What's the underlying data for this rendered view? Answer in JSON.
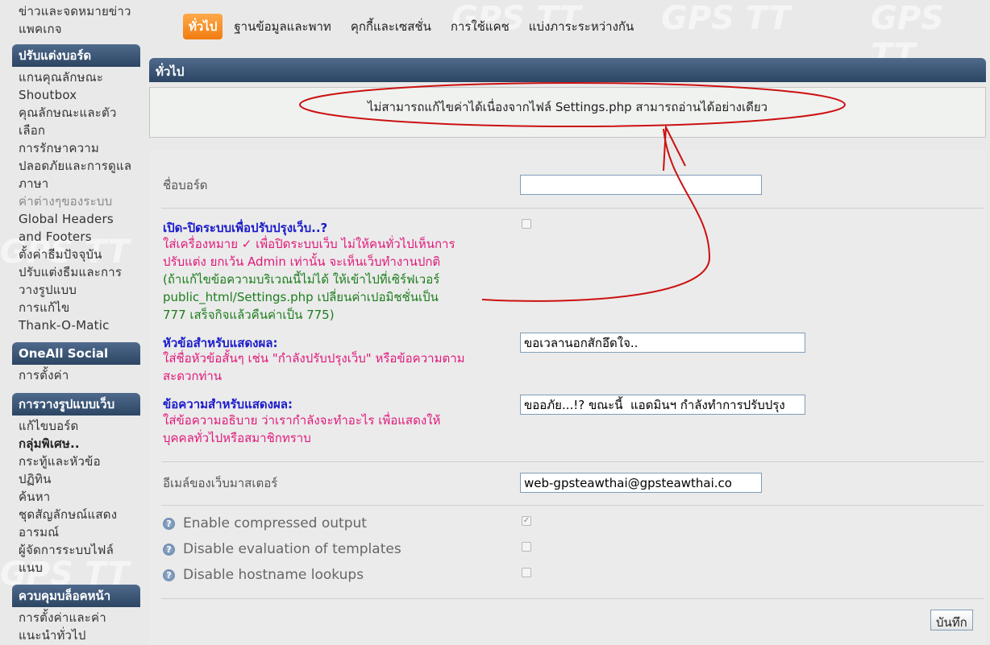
{
  "sidebar": {
    "top_items": [
      "ข่าวและจดหมายข่าว",
      "แพคเกจ"
    ],
    "groups": [
      {
        "title": "ปรับแต่งบอร์ด",
        "items": [
          "แกนคุณลักษณะ",
          "Shoutbox",
          "คุณลักษณะและตัว",
          "เลือก",
          "การรักษาความ",
          "ปลอดภัยและการดูแล",
          "ภาษา",
          "ค่าต่างๆของระบบ",
          "Global Headers",
          "and Footers",
          "ตั้งค่าธีมปัจจุบัน",
          "ปรับแต่งธีมและการ",
          "วางรูปแบบ",
          "การแก้ไข",
          "Thank-O-Matic"
        ]
      },
      {
        "title": "OneAll Social",
        "items": [
          "การตั้งค่า"
        ]
      },
      {
        "title": "การวางรูปแบบเว็บ",
        "items": [
          "แก้ไขบอร์ด",
          "กลุ่มพิเศษ..",
          "กระทู้และหัวข้อ",
          "ปฏิทิน",
          "ค้นหา",
          "ชุดสัญลักษณ์แสดง",
          "อารมณ์",
          "ผู้จัดการระบบไฟล์",
          "แนบ"
        ]
      },
      {
        "title": "ควบคุมบล็อคหน้า",
        "items": [
          "การตั้งค่าและค่า",
          "แนะนำทั่วไป"
        ]
      }
    ]
  },
  "tabs": [
    "ทั่วไป",
    "ฐานข้อมูลและพาท",
    "คุกกี้และเซสชั่น",
    "การใช้แคช",
    "แบ่งภาระระหว่างกัน"
  ],
  "category_title": "ทั่วไป",
  "notice": "ไม่สามารถแก้ไขค่าได้เนื่องจากไฟล์ Settings.php สามารถอ่านได้อย่างเดียว",
  "watermark": "GPS TT",
  "form": {
    "board_name_label": "ชื่อบอร์ด",
    "board_name_value": "",
    "maintenance_title": "เปิด-ปิดระบบเพื่อปรับปรุงเว็บ..?",
    "maintenance_desc_lines": [
      "ใส่เครื่องหมาย ✓  เพื่อปิดระบบเว็บ ไม่ให้คนทั่วไปเห็นการ",
      "ปรับแต่ง ยกเว้น Admin เท่านั้น จะเห็นเว็บทำงานปกติ"
    ],
    "maintenance_note_lines": [
      "(ถ้าแก้ไขข้อความบริเวณนี้ไม่ได้ ให้เข้าไปที่เซิร์ฟเวอร์",
      "public_html/Settings.php เปลี่ยนค่าเปอมิชชั่นเป็น",
      "777 เสร็จกิจแล้วคืนค่าเป็น 775)"
    ],
    "mtitle_title": "หัวข้อสำหรับแสดงผล:",
    "mtitle_desc_lines": [
      "ใส่ชื่อหัวข้อสั้นๆ เช่น \"กำลังปรับปรุงเว็บ\" หรือข้อความตาม",
      "สะดวกท่าน"
    ],
    "mtitle_value": "ขอเวลานอกสักอึดใจ..",
    "mmessage_title": "ข้อความสำหรับแสดงผล:",
    "mmessage_desc_lines": [
      "ใส่ข้อความอธิบาย ว่าเรากำลังจะทำอะไร เพื่อแสดงให้",
      "บุคคลทั่วไปหรือสมาชิกทราบ"
    ],
    "mmessage_value": "ขออภัย...!? ขณะนี้  แอดมินฯ กำลังทำการปรับปรุง",
    "webmaster_label": "อีเมล์ของเว็บมาสเตอร์",
    "webmaster_value": "web-gpsteawthai@gpsteawthai.co",
    "options": [
      {
        "label": "Enable compressed output",
        "checked": true
      },
      {
        "label": "Disable evaluation of templates",
        "checked": false
      },
      {
        "label": "Disable hostname lookups",
        "checked": false
      }
    ],
    "help_glyph": "?",
    "checkmark_glyph": "✓",
    "save_label": "บันทึก"
  },
  "colors": {
    "header_dark": "#2c4563",
    "tab_active": "#f07d10",
    "annotation": "#cc1111",
    "title_blue": "#1a1acc",
    "desc_magenta": "#e0187a",
    "note_green": "#1d7d1d"
  }
}
